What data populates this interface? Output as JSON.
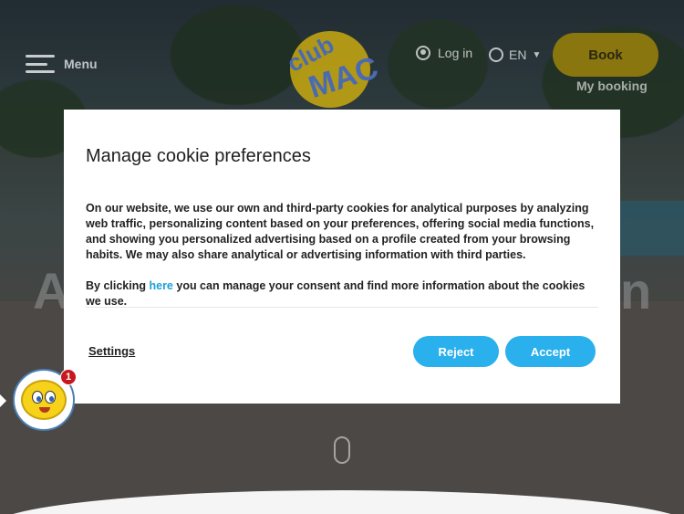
{
  "header": {
    "menu_label": "Menu",
    "logo_text_top": "club",
    "logo_text_bottom": "MAC",
    "login_label": "Log in",
    "language": "EN",
    "book_label": "Book",
    "my_booking_label": "My booking"
  },
  "hero": {
    "partial_left": "A",
    "partial_right": "n"
  },
  "cookie_modal": {
    "title": "Manage cookie preferences",
    "paragraph1": "On our website, we use our own and third-party cookies for analytical purposes by analyzing web traffic, personalizing content based on your preferences, offering social media functions, and showing you personalized advertising based on a profile created from your browsing habits. We may also share analytical or advertising information with third parties.",
    "paragraph2_before": "By clicking ",
    "paragraph2_link": "here",
    "paragraph2_after": " you can manage your consent and find more information about the cookies we use.",
    "settings_label": "Settings",
    "reject_label": "Reject",
    "accept_label": "Accept"
  },
  "chat": {
    "badge_count": "1"
  },
  "colors": {
    "accent": "#2ab0ec",
    "link": "#1b9fd8",
    "book_button": "#f2cf10",
    "badge": "#c8171e"
  }
}
